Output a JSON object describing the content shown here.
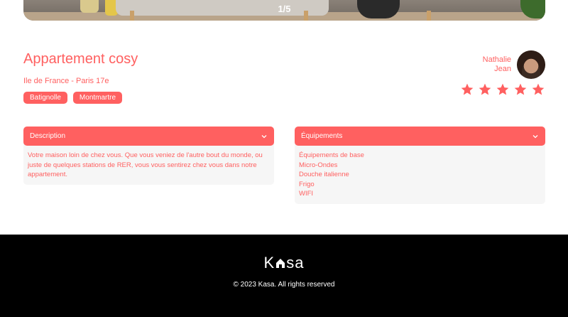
{
  "carousel": {
    "counter": "1/5"
  },
  "listing": {
    "title": "Appartement cosy",
    "location": "Ile de France - Paris 17e",
    "tags": [
      "Batignolle",
      "Montmartre"
    ]
  },
  "host": {
    "first_name": "Nathalie",
    "last_name": "Jean"
  },
  "rating": {
    "value": 5,
    "max": 5
  },
  "description": {
    "label": "Description",
    "text": "Votre maison loin de chez vous. Que vous veniez de l'autre bout du monde, ou juste de quelques stations de RER, vous vous sentirez chez vous dans notre appartement."
  },
  "equipments": {
    "label": "Équipements",
    "items": [
      "Équipements de base",
      "Micro-Ondes",
      "Douche italienne",
      "Frigo",
      "WIFI"
    ]
  },
  "footer": {
    "logo_left": "K",
    "logo_right": "sa",
    "copyright": "© 2023 Kasa. All rights reserved"
  },
  "colors": {
    "accent": "#ff6060",
    "panel": "#f6f6f6",
    "footer_bg": "#000000"
  }
}
